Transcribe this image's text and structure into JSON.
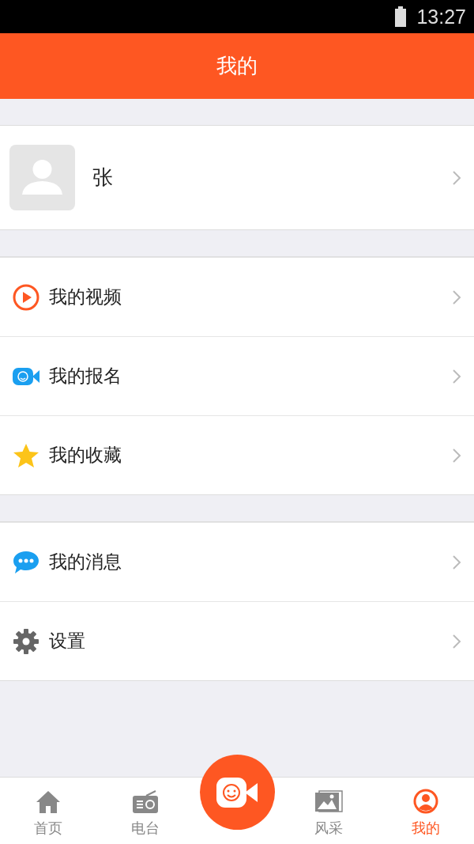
{
  "status_bar": {
    "time": "13:27"
  },
  "header": {
    "title": "我的"
  },
  "profile": {
    "name": "张"
  },
  "menu_groups": [
    {
      "items": [
        {
          "label": "我的视频",
          "kind": "video"
        },
        {
          "label": "我的报名",
          "kind": "signup"
        },
        {
          "label": "我的收藏",
          "kind": "favorite"
        }
      ]
    },
    {
      "items": [
        {
          "label": "我的消息",
          "kind": "message"
        },
        {
          "label": "设置",
          "kind": "settings"
        }
      ]
    }
  ],
  "tab_bar": {
    "tabs": [
      {
        "label": "首页",
        "kind": "home",
        "selected": false
      },
      {
        "label": "电台",
        "kind": "radio",
        "selected": false
      },
      {
        "kind": "record"
      },
      {
        "label": "风采",
        "kind": "gallery",
        "selected": false
      },
      {
        "label": "我的",
        "kind": "me",
        "selected": true
      }
    ]
  }
}
